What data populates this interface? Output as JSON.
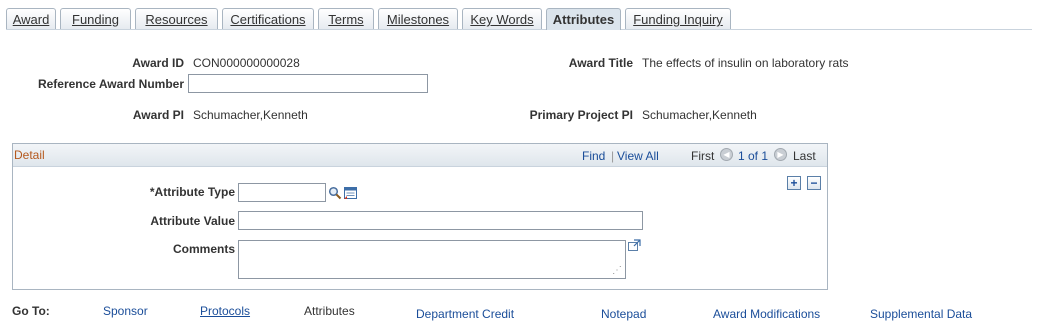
{
  "tabs": [
    {
      "label": "Award"
    },
    {
      "label": "Funding"
    },
    {
      "label": "Resources"
    },
    {
      "label": "Certifications"
    },
    {
      "label": "Terms"
    },
    {
      "label": "Milestones"
    },
    {
      "label": "Key Words"
    },
    {
      "label": "Attributes",
      "active": true
    },
    {
      "label": "Funding Inquiry"
    }
  ],
  "header": {
    "award_id_label": "Award ID",
    "award_id_value": "CON000000000028",
    "award_title_label": "Award Title",
    "award_title_value": "The effects of insulin on laboratory rats",
    "ref_award_label": "Reference Award Number",
    "ref_award_value": "",
    "award_pi_label": "Award PI",
    "award_pi_value": "Schumacher,Kenneth",
    "primary_pi_label": "Primary Project PI",
    "primary_pi_value": "Schumacher,Kenneth"
  },
  "detail": {
    "title": "Detail",
    "find_label": "Find",
    "separator": "|",
    "view_all_label": "View All",
    "first_label": "First",
    "counter": "1 of 1",
    "last_label": "Last",
    "add_symbol": "+",
    "remove_symbol": "−",
    "attr_type_label": "*Attribute Type",
    "attr_type_value": "",
    "attr_value_label": "Attribute Value",
    "attr_value_value": "",
    "comments_label": "Comments",
    "comments_value": ""
  },
  "goto": {
    "label": "Go To:",
    "links": [
      {
        "label": "Sponsor"
      },
      {
        "label": "Protocols"
      },
      {
        "label": "Attributes"
      },
      {
        "label": "Department Credit"
      },
      {
        "label": "Notepad"
      },
      {
        "label": "Award Modifications"
      },
      {
        "label": "Supplemental Data"
      }
    ]
  },
  "icons": {
    "lookup": "magnifier-icon",
    "prompt": "calendar-prompt-icon",
    "expand": "expand-textarea-icon"
  }
}
